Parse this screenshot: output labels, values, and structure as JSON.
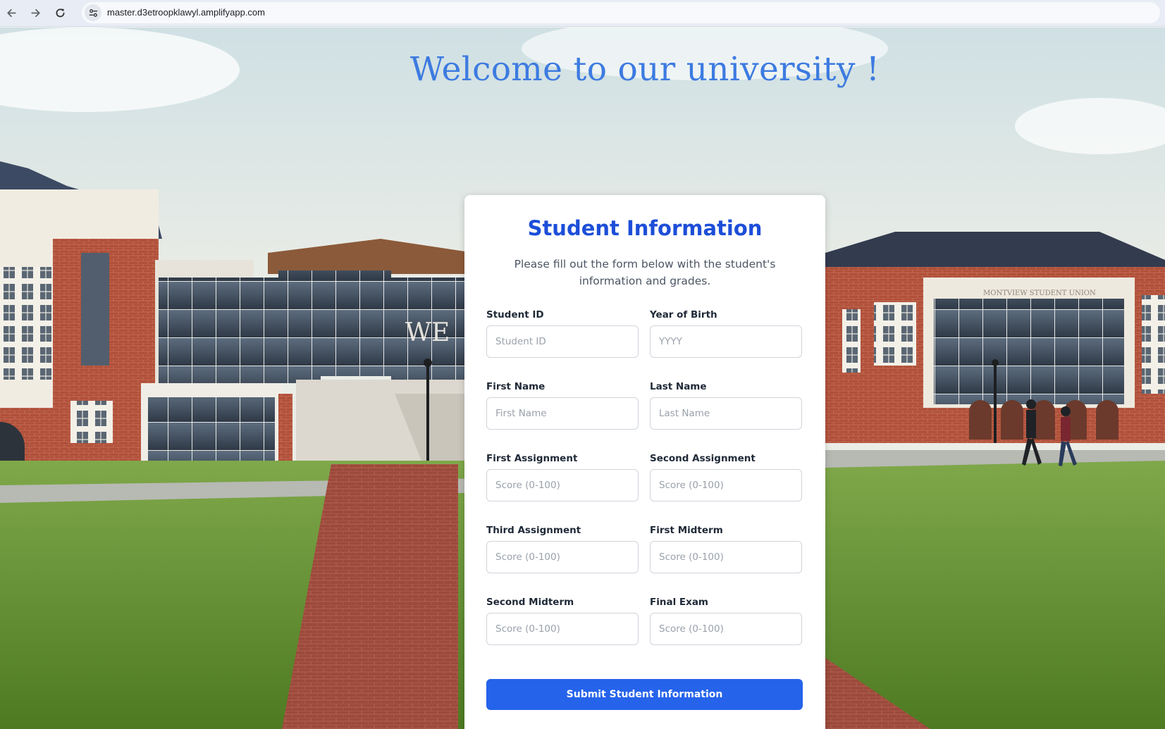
{
  "browser": {
    "url": "master.d3etroopklawyl.amplifyapp.com",
    "icons": [
      "back-arrow-icon",
      "forward-arrow-icon",
      "reload-icon",
      "site-info-icon"
    ]
  },
  "page": {
    "welcome": "Welcome to our university !",
    "background": "campus-buildings-and-lawn-photo",
    "building_sign": "MONTVIEW STUDENT UNION",
    "window_letters": "WE"
  },
  "form": {
    "title": "Student Information",
    "description": "Please fill out the form below with the student's information and grades.",
    "fields": [
      {
        "label": "Student ID",
        "placeholder": "Student ID",
        "value": ""
      },
      {
        "label": "Year of Birth",
        "placeholder": "YYYY",
        "value": ""
      },
      {
        "label": "First Name",
        "placeholder": "First Name",
        "value": ""
      },
      {
        "label": "Last Name",
        "placeholder": "Last Name",
        "value": ""
      },
      {
        "label": "First Assignment",
        "placeholder": "Score (0-100)",
        "value": ""
      },
      {
        "label": "Second Assignment",
        "placeholder": "Score (0-100)",
        "value": ""
      },
      {
        "label": "Third Assignment",
        "placeholder": "Score (0-100)",
        "value": ""
      },
      {
        "label": "First Midterm",
        "placeholder": "Score (0-100)",
        "value": ""
      },
      {
        "label": "Second Midterm",
        "placeholder": "Score (0-100)",
        "value": ""
      },
      {
        "label": "Final Exam",
        "placeholder": "Score (0-100)",
        "value": ""
      }
    ],
    "submit_label": "Submit Student Information"
  },
  "colors": {
    "welcome_text": "#3d7be0",
    "title": "#1d4ed8",
    "button": "#2563eb"
  }
}
